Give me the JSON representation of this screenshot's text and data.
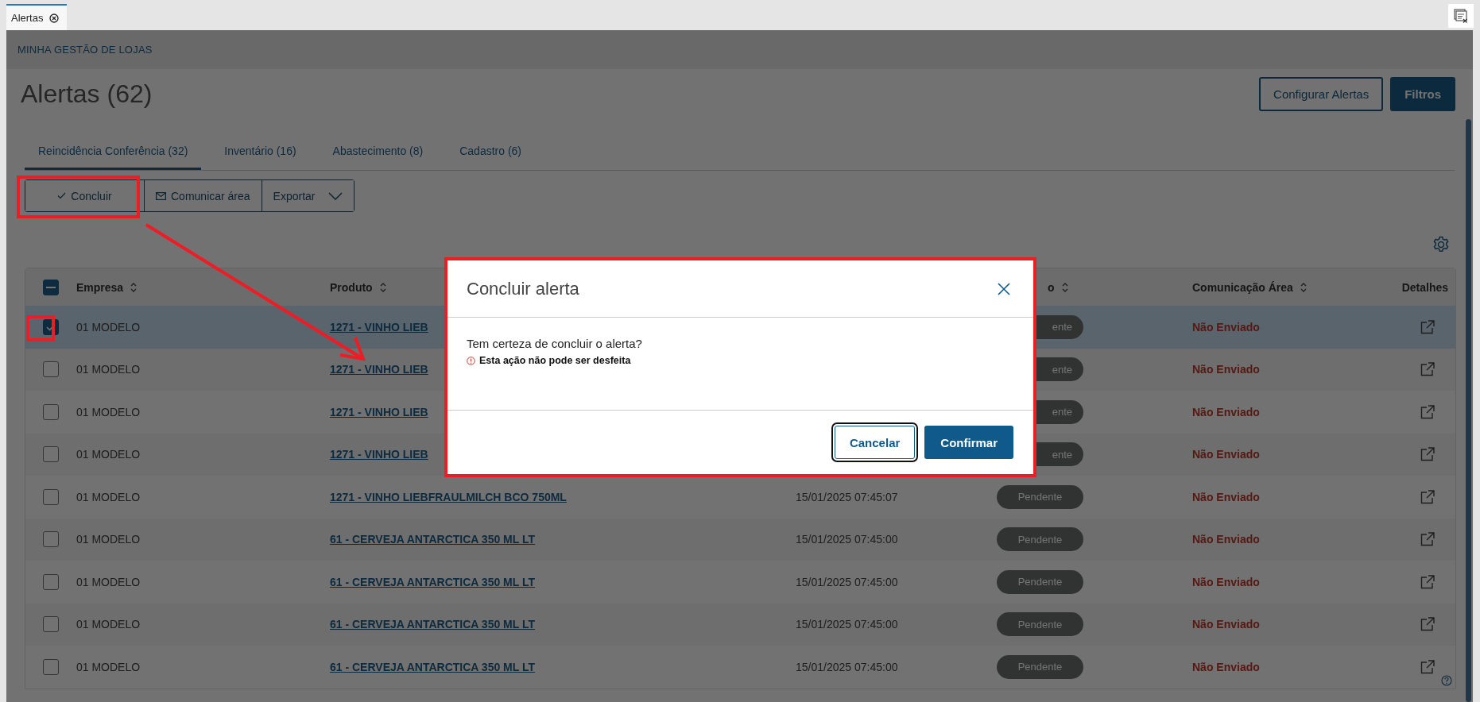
{
  "window_tab": {
    "label": "Alertas"
  },
  "breadcrumb": "MINHA GESTÃO DE LOJAS",
  "title": "Alertas (62)",
  "header_buttons": [
    {
      "label": "Configurar Alertas",
      "kind": "outline"
    },
    {
      "label": "Filtros",
      "kind": "primary"
    }
  ],
  "tabs": [
    {
      "label": "Reincidência Conferência (32)",
      "selected": true
    },
    {
      "label": "Inventário (16)",
      "selected": false
    },
    {
      "label": "Abastecimento (8)",
      "selected": false
    },
    {
      "label": "Cadastro (6)",
      "selected": false
    }
  ],
  "actions": [
    {
      "label": "Concluir",
      "kind": "check"
    },
    {
      "label": "Comunicar área",
      "kind": "mail"
    },
    {
      "label": "Exportar",
      "kind": "dropdown"
    }
  ],
  "table": {
    "select_all_partial": true,
    "columns": [
      {
        "label": "Empresa",
        "sortable": true
      },
      {
        "label": "Produto",
        "sortable": true
      },
      {
        "label": "o",
        "sortable": true
      },
      {
        "label": "Comunicação Área",
        "sortable": true
      },
      {
        "label": "Detalhes",
        "sortable": false
      }
    ],
    "rows": [
      {
        "selected": true,
        "checked": true,
        "empresa": "01 MODELO",
        "produto": "1271 - VINHO LIEB",
        "status": "ente",
        "status_clipped": true,
        "comunicacao": "Não Enviado"
      },
      {
        "selected": false,
        "checked": false,
        "empresa": "01 MODELO",
        "produto": "1271 - VINHO LIEB",
        "status": "ente",
        "status_clipped": true,
        "comunicacao": "Não Enviado"
      },
      {
        "selected": false,
        "checked": false,
        "empresa": "01 MODELO",
        "produto": "1271 - VINHO LIEB",
        "status": "ente",
        "status_clipped": true,
        "comunicacao": "Não Enviado"
      },
      {
        "selected": false,
        "checked": false,
        "empresa": "01 MODELO",
        "produto": "1271 - VINHO LIEB",
        "status": "ente",
        "status_clipped": true,
        "comunicacao": "Não Enviado"
      },
      {
        "selected": false,
        "checked": false,
        "empresa": "01 MODELO",
        "produto": "1271 - VINHO LIEBFRAULMILCH BCO 750ML",
        "data": "15/01/2025 07:45:07",
        "status": "Pendente",
        "status_clipped": false,
        "comunicacao": "Não Enviado"
      },
      {
        "selected": false,
        "checked": false,
        "empresa": "01 MODELO",
        "produto": "61 - CERVEJA ANTARCTICA 350 ML LT",
        "data": "15/01/2025 07:45:00",
        "status": "Pendente",
        "status_clipped": false,
        "comunicacao": "Não Enviado"
      },
      {
        "selected": false,
        "checked": false,
        "empresa": "01 MODELO",
        "produto": "61 - CERVEJA ANTARCTICA 350 ML LT",
        "data": "15/01/2025 07:45:00",
        "status": "Pendente",
        "status_clipped": false,
        "comunicacao": "Não Enviado"
      },
      {
        "selected": false,
        "checked": false,
        "empresa": "01 MODELO",
        "produto": "61 - CERVEJA ANTARCTICA 350 ML LT",
        "data": "15/01/2025 07:45:00",
        "status": "Pendente",
        "status_clipped": false,
        "comunicacao": "Não Enviado"
      },
      {
        "selected": false,
        "checked": false,
        "empresa": "01 MODELO",
        "produto": "61 - CERVEJA ANTARCTICA 350 ML LT",
        "data": "15/01/2025 07:45:00",
        "status": "Pendente",
        "status_clipped": false,
        "comunicacao": "Não Enviado"
      }
    ]
  },
  "dialog": {
    "title": "Concluir alerta",
    "message": "Tem certeza de concluir o alerta?",
    "warning": "Esta ação não pode ser desfeita",
    "buttons": [
      {
        "label": "Cancelar",
        "kind": "secondary",
        "focused": true
      },
      {
        "label": "Confirmar",
        "kind": "primary",
        "focused": false
      }
    ]
  }
}
